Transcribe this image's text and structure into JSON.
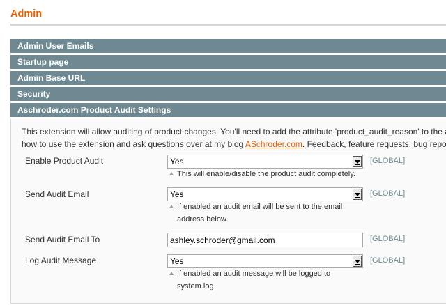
{
  "page": {
    "title": "Admin"
  },
  "sections": [
    {
      "label": "Admin User Emails"
    },
    {
      "label": "Startup page"
    },
    {
      "label": "Admin Base URL"
    },
    {
      "label": "Security"
    },
    {
      "label": "Aschroder.com Product Audit Settings"
    }
  ],
  "intro": {
    "line1": "This extension will allow auditing of product changes. You'll need to add the attribute 'product_audit_reason' to the attribute set",
    "line2_before": "how to use the extension and ask questions over at my blog ",
    "link": "ASchroder.com",
    "line2_after": ". Feedback, feature requests, bug reports"
  },
  "fields": {
    "enable_audit": {
      "label": "Enable Product Audit",
      "value": "Yes",
      "scope": "[GLOBAL]",
      "note": "This will enable/disable the product audit completely."
    },
    "send_email": {
      "label": "Send Audit Email",
      "value": "Yes",
      "scope": "[GLOBAL]",
      "note_line1": "If enabled an audit email will be sent to the email",
      "note_line2": "address below."
    },
    "email_to": {
      "label": "Send Audit Email To",
      "value": "ashley.schroder@gmail.com",
      "scope": "[GLOBAL]"
    },
    "log_message": {
      "label": "Log Audit Message",
      "value": "Yes",
      "scope": "[GLOBAL]",
      "note_line1": "If enabled an audit message will be logged to",
      "note_line2": "system.log"
    }
  },
  "colors": {
    "brand_orange": "#eb5e00",
    "section_header": "#6f8992"
  },
  "icons": [
    "dropdown-arrow-icon",
    "note-triangle-icon"
  ]
}
